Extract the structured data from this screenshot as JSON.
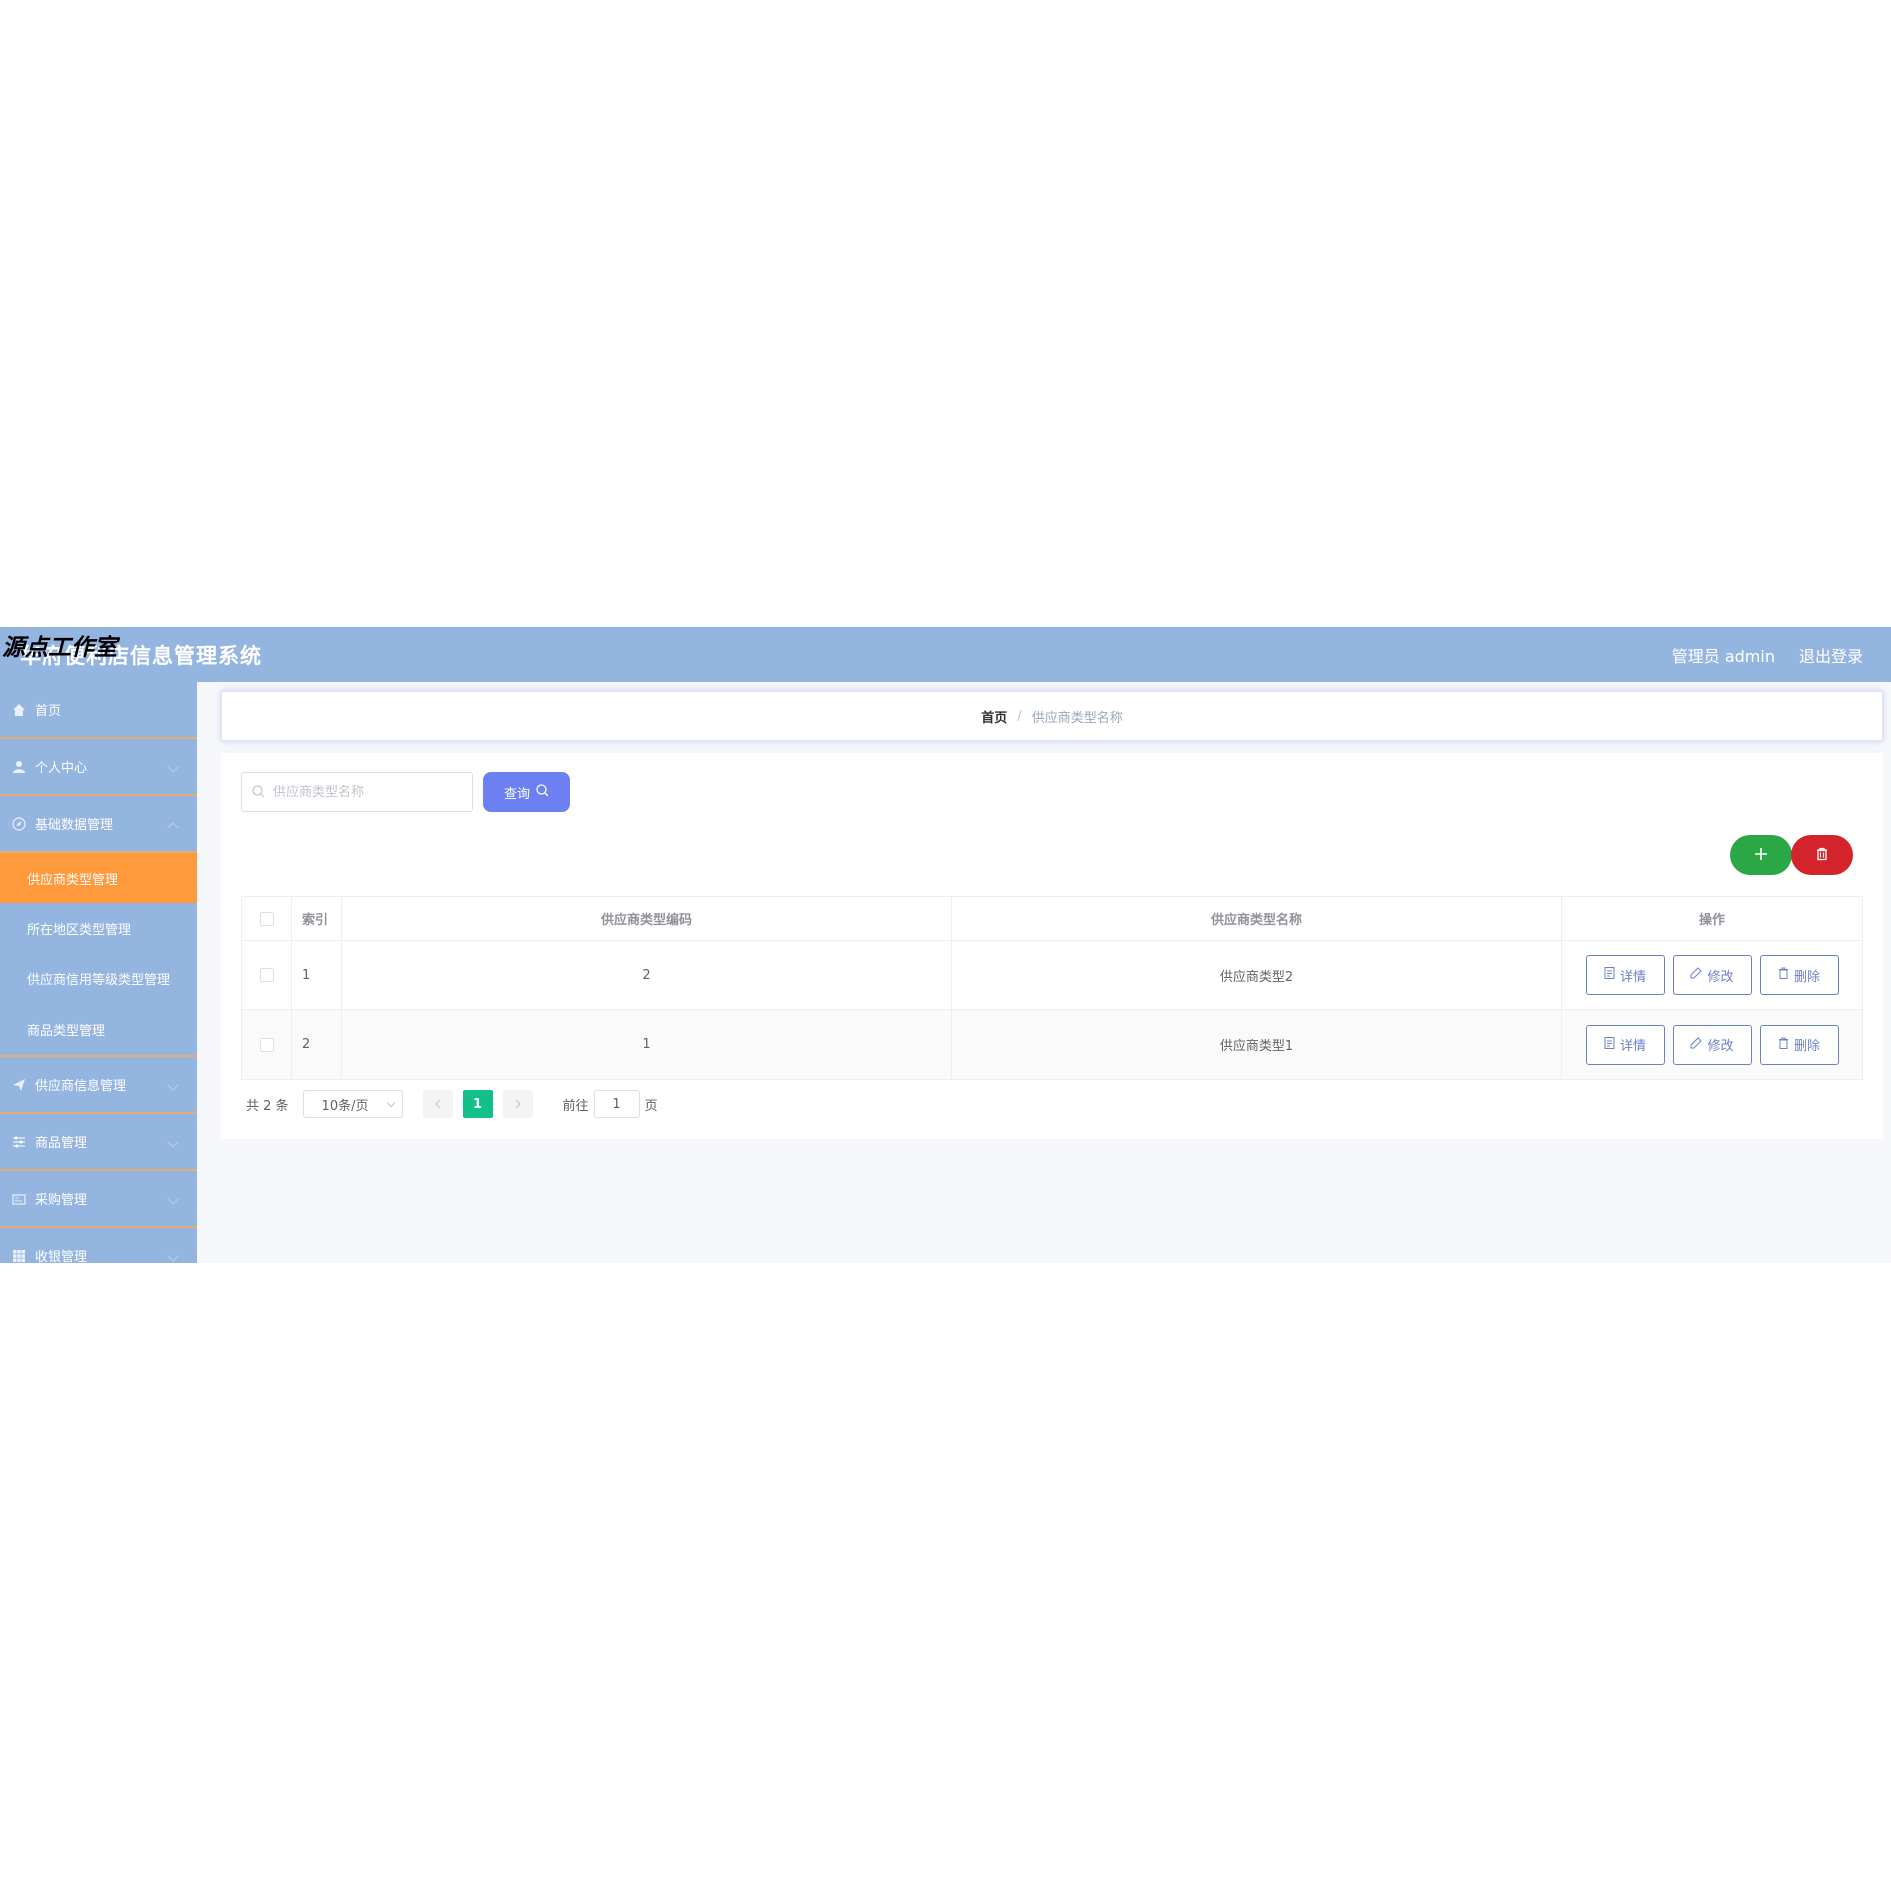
{
  "header": {
    "watermark": "源点工作室",
    "app_title": "华府便利店信息管理系统",
    "user_label": "管理员 admin",
    "logout_label": "退出登录"
  },
  "sidebar": {
    "items": [
      {
        "label": "首页",
        "icon": "home-icon"
      },
      {
        "label": "个人中心",
        "icon": "user-icon"
      },
      {
        "label": "基础数据管理",
        "icon": "compass-icon"
      },
      {
        "label": "供应商信息管理",
        "icon": "paper-plane-icon"
      },
      {
        "label": "商品管理",
        "icon": "sliders-icon"
      },
      {
        "label": "采购管理",
        "icon": "card-icon"
      },
      {
        "label": "收银管理",
        "icon": "grid-icon"
      }
    ],
    "subitems": [
      {
        "label": "供应商类型管理",
        "active": true
      },
      {
        "label": "所在地区类型管理",
        "active": false
      },
      {
        "label": "供应商信用等级类型管理",
        "active": false
      },
      {
        "label": "商品类型管理",
        "active": false
      }
    ]
  },
  "breadcrumb": {
    "home": "首页",
    "separator": "/",
    "current": "供应商类型名称"
  },
  "search": {
    "placeholder": "供应商类型名称",
    "value": "",
    "query_label": "查询"
  },
  "table": {
    "headers": [
      "索引",
      "供应商类型编码",
      "供应商类型名称",
      "操作"
    ],
    "rows": [
      {
        "index": "1",
        "code": "2",
        "name": "供应商类型2"
      },
      {
        "index": "2",
        "code": "1",
        "name": "供应商类型1"
      }
    ],
    "actions": {
      "detail": "详情",
      "edit": "修改",
      "delete": "删除"
    }
  },
  "pagination": {
    "total": "共 2 条",
    "page_size": "10条/页",
    "current_page": "1",
    "goto_label": "前往",
    "goto_value": "1",
    "page_suffix": "页"
  },
  "colors": {
    "header_bg": "#95b5e1",
    "sidebar_active": "#ff9a3c",
    "query_button": "#6c80f2",
    "add_button": "#2ba745",
    "delete_button": "#d3232b",
    "page_active": "#13c08a"
  }
}
